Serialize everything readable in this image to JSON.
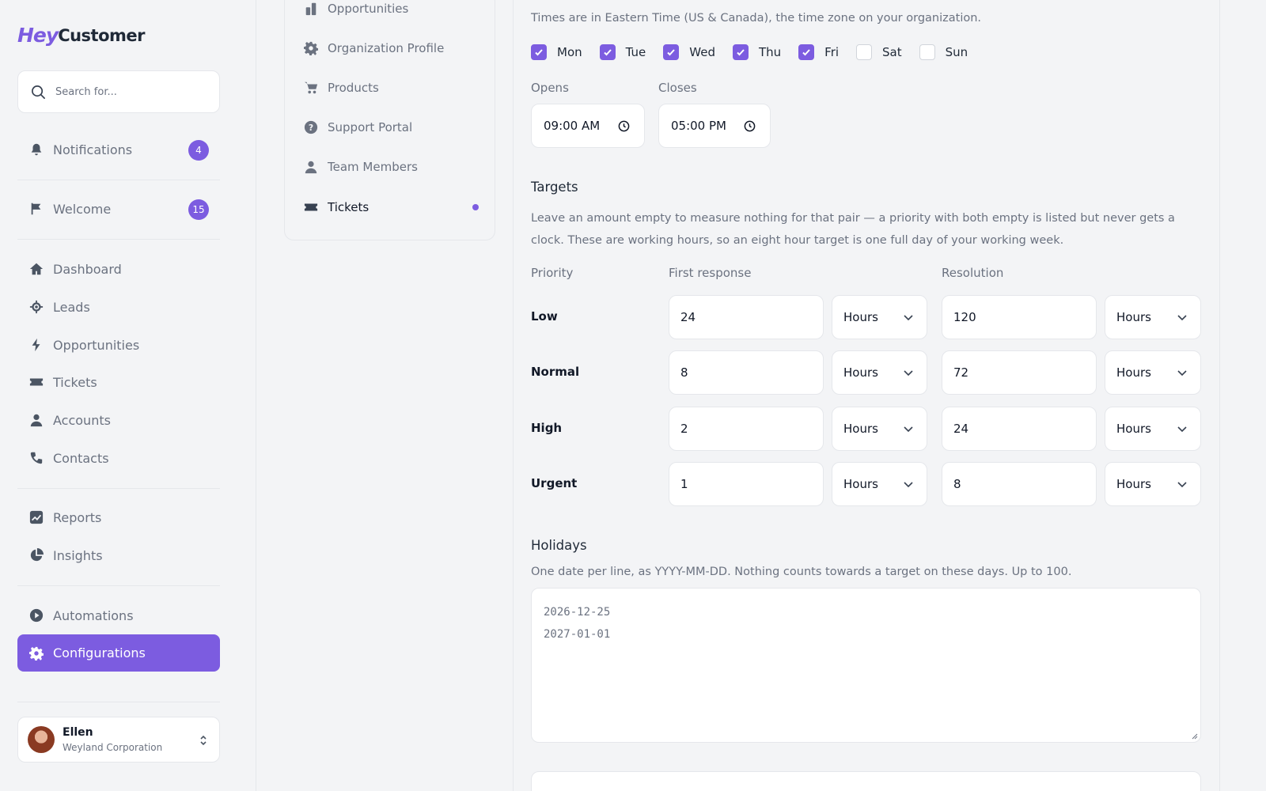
{
  "brand": {
    "hey": "Hey",
    "customer": "Customer",
    "accent": "#7c5ce0"
  },
  "search": {
    "placeholder": "Search for..."
  },
  "sidebar": {
    "items": [
      {
        "label": "Notifications",
        "icon": "bell-icon",
        "badge": "4"
      },
      {
        "label": "Welcome",
        "icon": "flag-icon",
        "badge": "15"
      },
      {
        "label": "Dashboard",
        "icon": "home-icon"
      },
      {
        "label": "Leads",
        "icon": "crosshair-icon"
      },
      {
        "label": "Opportunities",
        "icon": "bolt-icon"
      },
      {
        "label": "Tickets",
        "icon": "ticket-icon"
      },
      {
        "label": "Accounts",
        "icon": "user-icon"
      },
      {
        "label": "Contacts",
        "icon": "phone-icon"
      },
      {
        "label": "Reports",
        "icon": "chart-icon"
      },
      {
        "label": "Insights",
        "icon": "pie-icon"
      },
      {
        "label": "Automations",
        "icon": "play-icon"
      },
      {
        "label": "Configurations",
        "icon": "gear-icon",
        "active": true
      }
    ]
  },
  "user": {
    "name": "Ellen",
    "org": "Weyland Corporation"
  },
  "subnav": {
    "items": [
      {
        "label": "Opportunities",
        "icon": "bars-icon"
      },
      {
        "label": "Organization Profile",
        "icon": "gear-icon"
      },
      {
        "label": "Products",
        "icon": "cart-icon"
      },
      {
        "label": "Support Portal",
        "icon": "question-icon"
      },
      {
        "label": "Team Members",
        "icon": "user-icon"
      },
      {
        "label": "Tickets",
        "icon": "ticket-icon",
        "active": true
      }
    ]
  },
  "hours": {
    "timezone_note": "Times are in Eastern Time (US & Canada), the time zone on your organization.",
    "days": [
      {
        "label": "Mon",
        "checked": true
      },
      {
        "label": "Tue",
        "checked": true
      },
      {
        "label": "Wed",
        "checked": true
      },
      {
        "label": "Thu",
        "checked": true
      },
      {
        "label": "Fri",
        "checked": true
      },
      {
        "label": "Sat",
        "checked": false
      },
      {
        "label": "Sun",
        "checked": false
      }
    ],
    "opens_label": "Opens",
    "opens_value": "09:00 AM",
    "closes_label": "Closes",
    "closes_value": "05:00 PM"
  },
  "targets": {
    "title": "Targets",
    "description": "Leave an amount empty to measure nothing for that pair — a priority with both empty is listed but never gets a clock. These are working hours, so an eight hour target is one full day of your working week.",
    "col_priority": "Priority",
    "col_first_response": "First response",
    "col_resolution": "Resolution",
    "rows": [
      {
        "priority": "Low",
        "first": "24",
        "first_unit": "Hours",
        "resolution": "120",
        "resolution_unit": "Hours"
      },
      {
        "priority": "Normal",
        "first": "8",
        "first_unit": "Hours",
        "resolution": "72",
        "resolution_unit": "Hours"
      },
      {
        "priority": "High",
        "first": "2",
        "first_unit": "Hours",
        "resolution": "24",
        "resolution_unit": "Hours"
      },
      {
        "priority": "Urgent",
        "first": "1",
        "first_unit": "Hours",
        "resolution": "8",
        "resolution_unit": "Hours"
      }
    ]
  },
  "holidays": {
    "title": "Holidays",
    "description": "One date per line, as YYYY-MM-DD. Nothing counts towards a target on these days. Up to 100.",
    "placeholder_line1": "2026-12-25",
    "placeholder_line2": "2027-01-01"
  }
}
